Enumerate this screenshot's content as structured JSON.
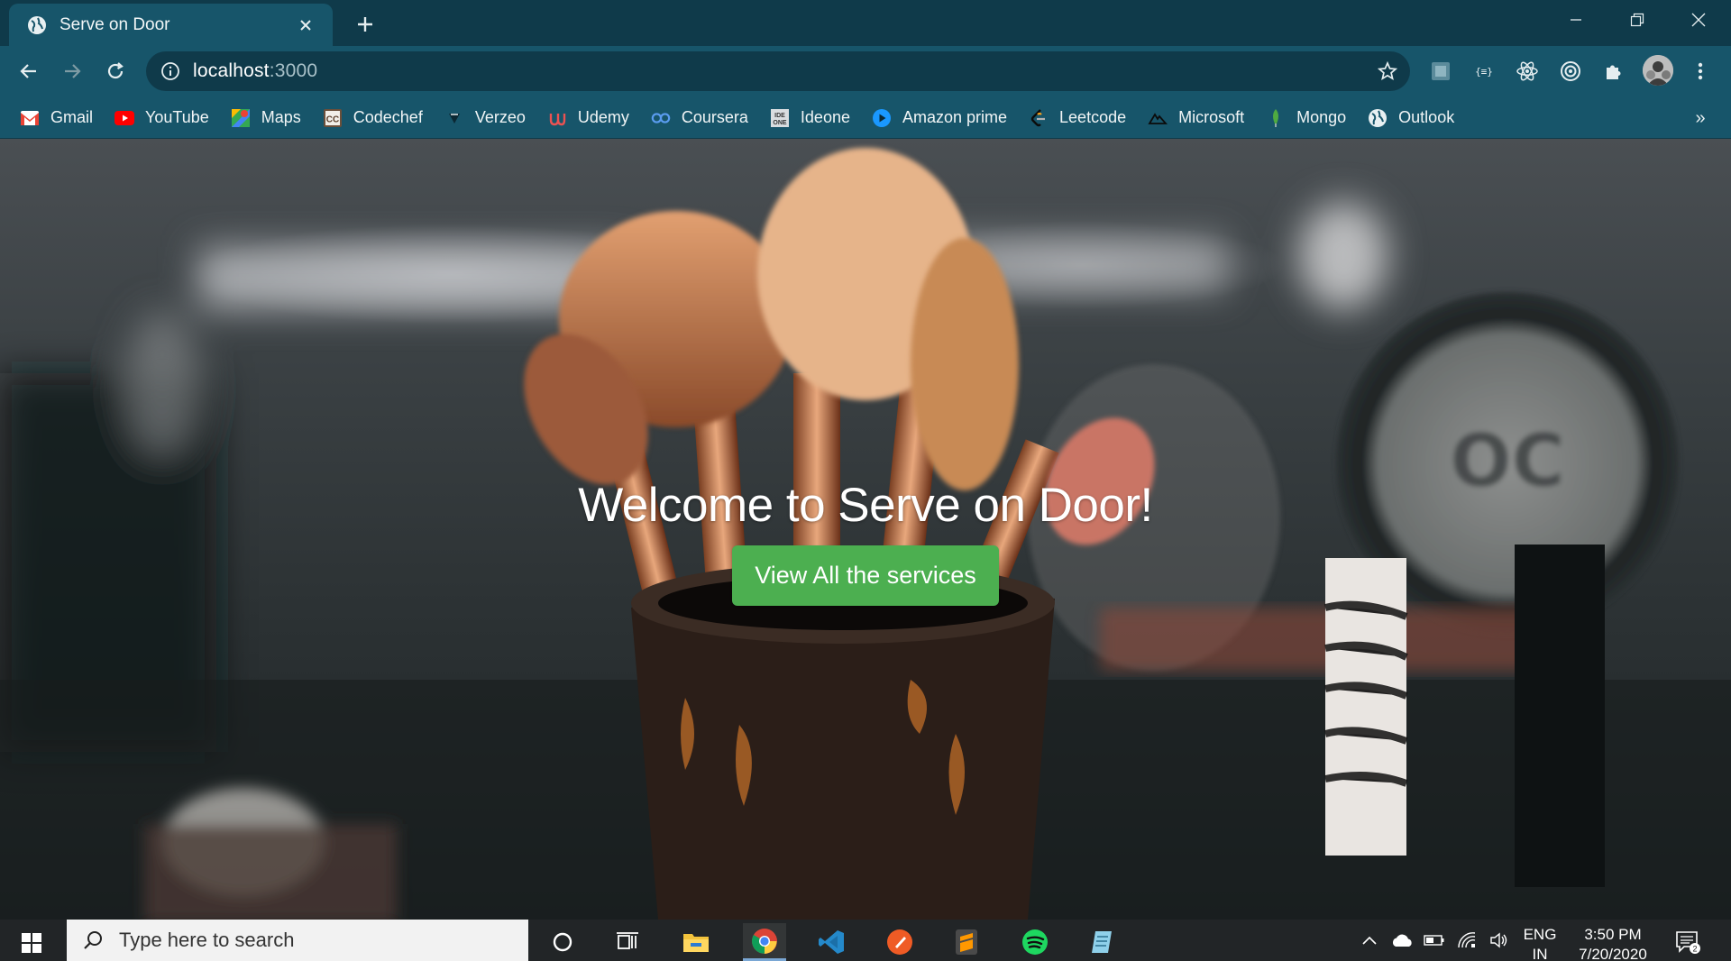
{
  "browser": {
    "tab_title": "Serve on Door",
    "url_host": "localhost",
    "url_port": ":3000",
    "window_controls": [
      "minimize",
      "restore",
      "close"
    ]
  },
  "bookmarks": [
    {
      "label": "Gmail",
      "icon": "gmail-icon"
    },
    {
      "label": "YouTube",
      "icon": "youtube-icon"
    },
    {
      "label": "Maps",
      "icon": "maps-icon"
    },
    {
      "label": "Codechef",
      "icon": "codechef-icon"
    },
    {
      "label": "Verzeo",
      "icon": "verzeo-icon"
    },
    {
      "label": "Udemy",
      "icon": "udemy-icon"
    },
    {
      "label": "Coursera",
      "icon": "coursera-icon"
    },
    {
      "label": "Ideone",
      "icon": "ideone-icon"
    },
    {
      "label": "Amazon prime",
      "icon": "amazon-prime-icon"
    },
    {
      "label": "Leetcode",
      "icon": "leetcode-icon"
    },
    {
      "label": "Microsoft",
      "icon": "microsoft-icon"
    },
    {
      "label": "Mongo",
      "icon": "mongo-icon"
    },
    {
      "label": "Outlook",
      "icon": "outlook-icon"
    }
  ],
  "bookmarks_more": "»",
  "hero": {
    "title": "Welcome to Serve on Door!",
    "button_label": "View All the services",
    "button_color": "#4caf50"
  },
  "taskbar": {
    "search_placeholder": "Type here to search",
    "apps": [
      "cortana-icon",
      "task-view-icon",
      "file-explorer-icon",
      "chrome-icon",
      "vscode-icon",
      "postman-icon",
      "sublime-text-icon",
      "spotify-icon",
      "notepad-icon"
    ],
    "language": "ENG",
    "region": "IN",
    "time": "3:50 PM",
    "date": "7/20/2020",
    "notification_count": "2"
  },
  "colors": {
    "chrome_dark": "#0f3a4a",
    "chrome_light": "#17556a",
    "taskbar": "#222527"
  }
}
